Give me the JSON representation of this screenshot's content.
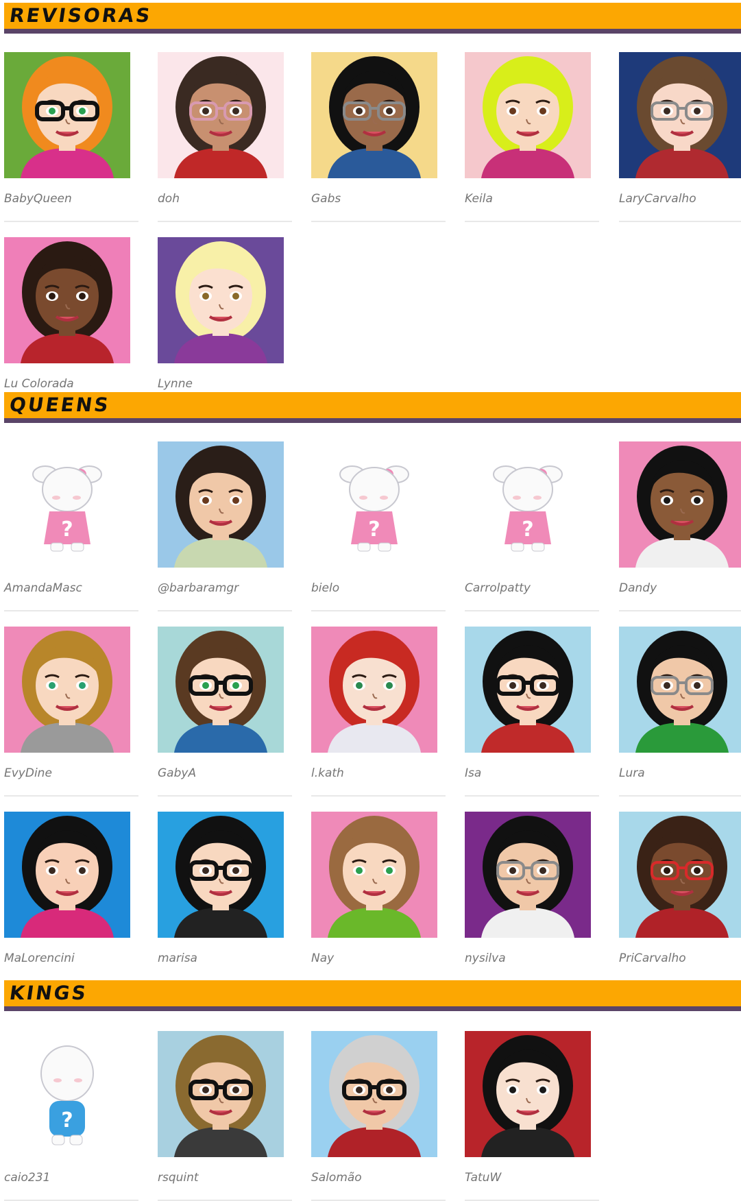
{
  "sections": [
    {
      "title": "REVISORAS",
      "members": [
        {
          "name": "BabyQueen",
          "bg": "#6aaa3a",
          "skin": "#f8d8c0",
          "hair": "#f08a1e",
          "shirt": "#d8308a",
          "glasses": "black",
          "eyes": "#2aa050"
        },
        {
          "name": "doh",
          "bg": "#fbe6ea",
          "skin": "#c89070",
          "hair": "#3a2a22",
          "shirt": "#c02828",
          "glasses": "pink",
          "eyes": "#3a2a22"
        },
        {
          "name": "Gabs",
          "bg": "#f5d98a",
          "skin": "#9a6a4a",
          "hair": "#111111",
          "shirt": "#2a5a9a",
          "glasses": "gray",
          "eyes": "#3a2a22"
        },
        {
          "name": "Keila",
          "bg": "#f5c8cc",
          "skin": "#f8d8c0",
          "hair": "#d8ee1a",
          "shirt": "#c83078",
          "glasses": "none",
          "eyes": "#6a3a1e"
        },
        {
          "name": "LaryCarvalho",
          "bg": "#1e3a7a",
          "skin": "#f8d8c8",
          "hair": "#6a4a30",
          "shirt": "#b02a30",
          "glasses": "gray",
          "eyes": "#3a2a22"
        },
        {
          "name": "Lu Colorada",
          "bg": "#ef7fb8",
          "skin": "#7a4a2e",
          "hair": "#2a1a12",
          "shirt": "#b8242c",
          "glasses": "none",
          "eyes": "#2a1a12"
        },
        {
          "name": "Lynne",
          "bg": "#6a4a9a",
          "skin": "#fbe0d0",
          "hair": "#f8f0a8",
          "shirt": "#8a3a9a",
          "glasses": "none",
          "eyes": "#8a6a2a"
        }
      ]
    },
    {
      "title": "QUEENS",
      "members": [
        {
          "name": "AmandaMasc",
          "placeholder": true,
          "variant": "girl"
        },
        {
          "name": "@barbaramgr",
          "bg": "#9ac8e8",
          "skin": "#f0c8a8",
          "hair": "#2a1e18",
          "shirt": "#c8d8b0",
          "glasses": "none",
          "eyes": "#6a3a1e"
        },
        {
          "name": "bielo",
          "placeholder": true,
          "variant": "girl"
        },
        {
          "name": "Carrolpatty",
          "placeholder": true,
          "variant": "girl"
        },
        {
          "name": "Dandy",
          "bg": "#ef8ab8",
          "skin": "#8a5a38",
          "hair": "#111111",
          "shirt": "#f0f0f0",
          "glasses": "none",
          "eyes": "#1a1a1a"
        },
        {
          "name": "EvyDine",
          "bg": "#ef8ab8",
          "skin": "#f8d8c0",
          "hair": "#b8862a",
          "shirt": "#9a9a9a",
          "glasses": "none",
          "eyes": "#2aa070"
        },
        {
          "name": "GabyA",
          "bg": "#a8d8d8",
          "skin": "#f8d8c0",
          "hair": "#5a3a22",
          "shirt": "#2a6aaa",
          "glasses": "black",
          "eyes": "#2aa050"
        },
        {
          "name": "l.kath",
          "bg": "#ef8ab8",
          "skin": "#f8e0d0",
          "hair": "#c82a22",
          "shirt": "#e8e8f0",
          "glasses": "none",
          "eyes": "#2a8a50"
        },
        {
          "name": "Isa",
          "bg": "#a8d8ea",
          "skin": "#f8d8c0",
          "hair": "#111111",
          "shirt": "#c02a2a",
          "glasses": "black",
          "eyes": "#3a2a22"
        },
        {
          "name": "Lura",
          "bg": "#a8d8ea",
          "skin": "#f0c8a8",
          "hair": "#111111",
          "shirt": "#2a9a3a",
          "glasses": "gray",
          "eyes": "#3a2a22"
        },
        {
          "name": "MaLorencini",
          "bg": "#1e8ad8",
          "skin": "#f8d0b8",
          "hair": "#111111",
          "shirt": "#d82a7a",
          "glasses": "none",
          "eyes": "#3a2a22"
        },
        {
          "name": "marisa",
          "bg": "#28a0e0",
          "skin": "#f8d8c0",
          "hair": "#111111",
          "shirt": "#222222",
          "glasses": "black",
          "eyes": "#3a2a22"
        },
        {
          "name": "Nay",
          "bg": "#ef8ab8",
          "skin": "#f8d8c0",
          "hair": "#9a6a40",
          "shirt": "#6ab82a",
          "glasses": "none",
          "eyes": "#2aa050"
        },
        {
          "name": "nysilva",
          "bg": "#7a2a8a",
          "skin": "#f0c8a8",
          "hair": "#111111",
          "shirt": "#f0f0f0",
          "glasses": "gray",
          "eyes": "#3a2a22"
        },
        {
          "name": "PriCarvalho",
          "bg": "#a8d8ea",
          "skin": "#7a4a2e",
          "hair": "#3a2216",
          "shirt": "#b02228",
          "glasses": "red",
          "eyes": "#2a1a12"
        }
      ]
    },
    {
      "title": "KINGS",
      "members": [
        {
          "name": "caio231",
          "placeholder": true,
          "variant": "boy"
        },
        {
          "name": "rsquint",
          "bg": "#a8d0e0",
          "skin": "#f0c8a8",
          "hair": "#8a6a30",
          "shirt": "#3a3a3a",
          "glasses": "black",
          "eyes": "#3a2a22"
        },
        {
          "name": "Salomão",
          "bg": "#9ad0f0",
          "skin": "#f0c8a8",
          "hair": "#d0d0d0",
          "shirt": "#b02228",
          "glasses": "black",
          "eyes": "#3a2a22"
        },
        {
          "name": "TatuW",
          "bg": "#b8242a",
          "skin": "#f8e0d0",
          "hair": "#111111",
          "shirt": "#222222",
          "glasses": "none",
          "eyes": "#1a1a1a"
        }
      ]
    }
  ]
}
